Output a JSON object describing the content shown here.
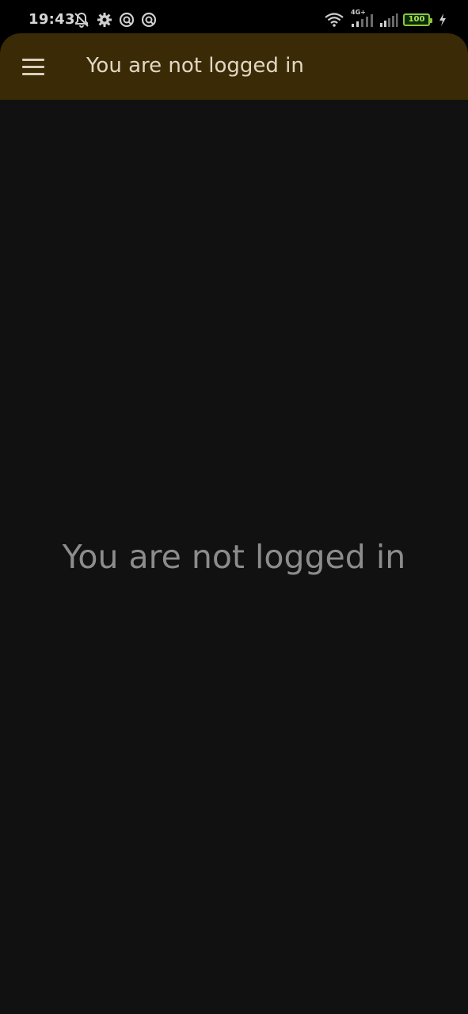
{
  "status_bar": {
    "time": "19:43",
    "left_icons": [
      "bell-off-icon",
      "gear-icon",
      "circle-app-icon",
      "circle-app-icon"
    ],
    "right_icons": [
      "wifi-icon",
      "signal-4g-icon",
      "signal-icon",
      "battery-icon",
      "charging-icon"
    ],
    "network_label": "4G+",
    "battery_level": "100",
    "battery_color": "#8dc63f"
  },
  "app_bar": {
    "title": "You are not logged in",
    "background": "#3a2a05"
  },
  "main": {
    "message": "You are not logged in",
    "background": "#111111"
  }
}
